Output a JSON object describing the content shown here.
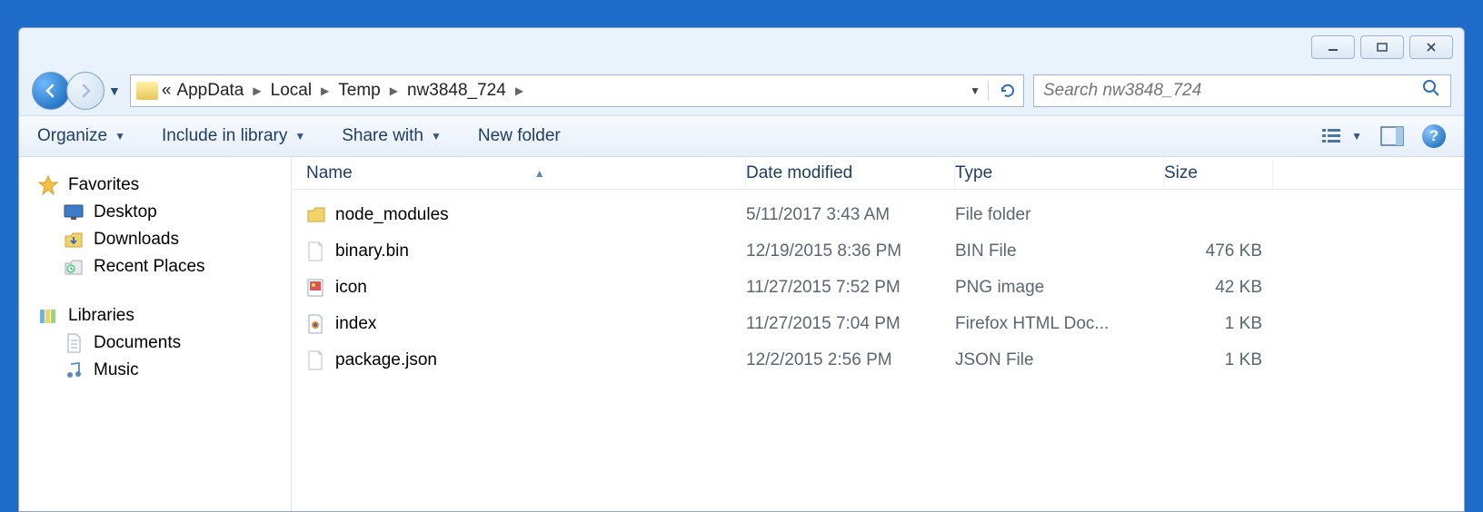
{
  "breadcrumb": {
    "prefix": "«",
    "items": [
      "AppData",
      "Local",
      "Temp",
      "nw3848_724"
    ]
  },
  "search": {
    "placeholder": "Search nw3848_724"
  },
  "toolbar": {
    "organize": "Organize",
    "include": "Include in library",
    "share": "Share with",
    "newfolder": "New folder"
  },
  "columns": {
    "name": "Name",
    "date": "Date modified",
    "type": "Type",
    "size": "Size"
  },
  "sidebar": {
    "favorites": {
      "label": "Favorites",
      "items": [
        "Desktop",
        "Downloads",
        "Recent Places"
      ]
    },
    "libraries": {
      "label": "Libraries",
      "items": [
        "Documents",
        "Music"
      ]
    }
  },
  "files": [
    {
      "name": "node_modules",
      "date": "5/11/2017 3:43 AM",
      "type": "File folder",
      "size": "",
      "icon": "folder"
    },
    {
      "name": "binary.bin",
      "date": "12/19/2015 8:36 PM",
      "type": "BIN File",
      "size": "476 KB",
      "icon": "blank"
    },
    {
      "name": "icon",
      "date": "11/27/2015 7:52 PM",
      "type": "PNG image",
      "size": "42 KB",
      "icon": "image"
    },
    {
      "name": "index",
      "date": "11/27/2015 7:04 PM",
      "type": "Firefox HTML Doc...",
      "size": "1 KB",
      "icon": "html"
    },
    {
      "name": "package.json",
      "date": "12/2/2015 2:56 PM",
      "type": "JSON File",
      "size": "1 KB",
      "icon": "blank"
    }
  ]
}
